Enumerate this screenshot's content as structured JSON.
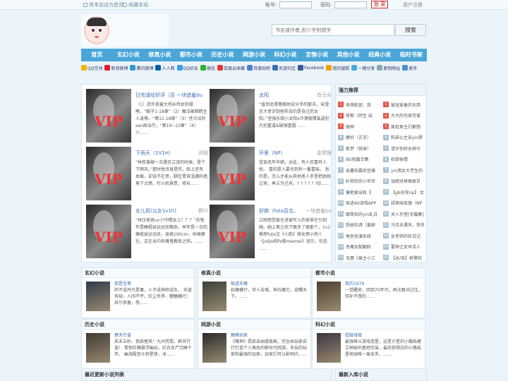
{
  "topbar": {
    "set_home": "将本站设为首页",
    "bookmark": "收藏本站",
    "account_label": "账号:",
    "password_label": "密码:",
    "login_button": "登 录",
    "register": "用户注册"
  },
  "search": {
    "placeholder": "书名或作者,别少字别错字",
    "button": "搜索"
  },
  "nav": [
    "首页",
    "玄幻小说",
    "修真小说",
    "都市小说",
    "历史小说",
    "网游小说",
    "科幻小说",
    "言情小说",
    "其他小说",
    "经典小说",
    "临时书架"
  ],
  "share": [
    {
      "label": "QQ空间",
      "color": "#f5b400"
    },
    {
      "label": "新浪微博",
      "color": "#e6162d"
    },
    {
      "label": "腾讯微博",
      "color": "#2c9bd6"
    },
    {
      "label": "人人网",
      "color": "#005eac"
    },
    {
      "label": "QQ好友",
      "color": "#3d9be9"
    },
    {
      "label": "微信",
      "color": "#2ab32d"
    },
    {
      "label": "百度云收藏",
      "color": "#e53935"
    },
    {
      "label": "百度贴吧",
      "color": "#4a7fd0"
    },
    {
      "label": "天涯社区",
      "color": "#3a6fb0"
    },
    {
      "label": "Facebook",
      "color": "#3b5998"
    },
    {
      "label": "我的搜狐",
      "color": "#f0a000"
    },
    {
      "label": "一键分享",
      "color": "#4aa6d8"
    },
    {
      "label": "复制网址",
      "color": "#8aa"
    },
    {
      "label": "更多",
      "color": "#4a8ed8"
    }
  ],
  "vip_books": [
    {
      "title": "日完请给好评（百 一块遮羞bu",
      "author": "",
      "desc": "（1）逆外卖被大鸡长鸡女的侵略，“脑子1-18章”（2）魔法被暗鹤主人凌辱。“第11-18章”（3）性冷淡的san病治疗。“第19~23章”（4）少......"
    },
    {
      "title": "太阳",
      "author": "俭马头",
      "desc": "“直到池清菁跟他说分手的那天，宋澄言才意识到他失去的是自己的太阳。”坚强乐观小太阳x冷漠隐情装逼犯 久别重逢&破镜重圆 ......"
    },
    {
      "title": "下雨天（1V1H）",
      "author": "河枝",
      "desc": "“林贫兽被一次遇见江泽的时候，是个下雨天。”那时他浑身是伤，脸上还有血痕，却没不在意，脚往青苔湿漉的墙角下点燃，打火机悬贵，修长......"
    },
    {
      "title": "环里（NP）",
      "author": "金帮银",
      "desc": "宫束风年华绩，对此，有人欢喜有人愁。 喜的是人要也到有一番喜味。 愁的是，怎么才能从其他男人手里把她抢过来，再占为己有。? ? ? ? ? ?珍......"
    },
    {
      "title": "女儿奴(父女1v1h)",
      "author": "野川",
      "desc": "“林汉爸爸uv少作精女儿？？？”苏牧年是睡棍球运动员教练，早年是一次的橄榄球运动员，身高190cm，体格健壮。这在业内有魔鬼教练之称。......"
    },
    {
      "title": "好腕（futa百合。",
      "author": "一块遮羞bu",
      "desc": "江映感觉爱住进被写入的背景在引到她。她上辈之后下面多了根那个，1v1推荐futa文《小韵》继女邢小热!!《jutjie和fx做meimei》班尔，包括 ......"
    }
  ],
  "rank": {
    "heading": "强力推荐",
    "items": [
      "呆萌蛇奴：我",
      "被宠爱着的东西",
      "修郁（师生 出",
      "大大的也很可爱",
      "微神",
      "疯批男主们都想",
      "碧好（古言）",
      "和弟公主安yin孽",
      "新梦（快穿）",
      "请许你转女神守",
      "BG短篇合集",
      "权欲偷情",
      "肯蔓权霸后宫爆",
      "yin荡女大学生的",
      "扑朔你的小世世",
      "蚀绩对爽根疯巨",
      "偏他爱出轨【",
      "【gb总攻np】 女",
      "穿进AV游戏APP",
      "绿茶味玫瑰（NP",
      "跟哥后的yin乱日",
      "关人作茎[中篇集]",
      "受她勾诱（姜娘",
      "冷月未遇天，惊世",
      "角色扮演系统",
      "女老师的狂日记",
      "恶毒女配翻脸",
      "要神之女孕活人",
      "无唇《竟主小三",
      "【总/攻】射警校"
    ]
  },
  "sections": [
    {
      "heading": "玄幻小说",
      "book": "我是至尊",
      "desc": "药不成丹只是毒，人不成神终成灰。 天道有缺，人间不平，红尘世界，魍魉横行；哀尔良善，怒......"
    },
    {
      "heading": "修真小说",
      "book": "极道天魔",
      "desc": "妖魔横行，世人苦难。神兵魔刃，迎曙天下。......"
    },
    {
      "heading": "都市小说",
      "book": "我的1979",
      "desc": "一觉醒来，回到70年代，再次面对过往，弥补不想的……"
    },
    {
      "heading": "历史小说",
      "book": "替天行盗",
      "desc": "风未五秒，我欲替风！九州荒霞，群天行盗！ 青铜巨棘悬浮幽谷，红衣女尸沉睡千年。 幽海殿宫斗转星移，冰......"
    },
    {
      "heading": "网游小说",
      "book": "巅峰玩家",
      "desc": "《路神》是款自由度极高，完全由玩家自行打造个人角色的新时代网游。多玩的玩家和最强的玩家，玩家们可以影响内......"
    },
    {
      "heading": "科幻小说",
      "book": "超级母舰",
      "desc": "最强格斗游戏造星，这是计星的小路船建立神秘的基地宇宙，最后获得白的小路船是地球唯一竟击手，……"
    }
  ],
  "bottom": {
    "left": "最近更新小说列表",
    "right": "最新入库小说"
  }
}
